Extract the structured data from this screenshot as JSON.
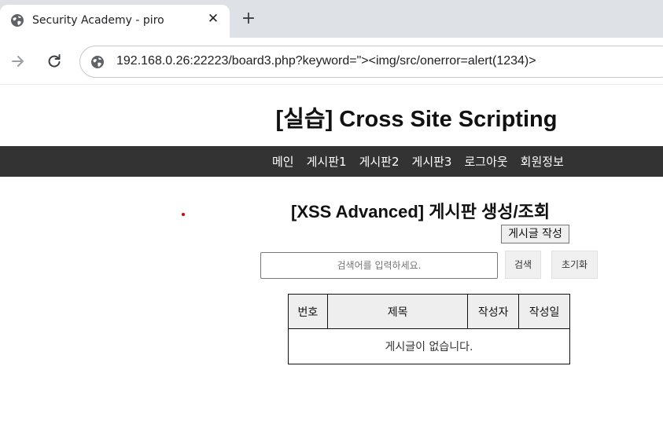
{
  "browser": {
    "tab_title": "Security Academy - piro",
    "close_glyph": "✕",
    "new_tab_glyph": "+",
    "url": "192.168.0.26:22223/board3.php?keyword=\"><img/src/onerror=alert(1234)>"
  },
  "page": {
    "title": "[실습] Cross Site Scripting",
    "nav": [
      "메인",
      "게시판1",
      "게시판2",
      "게시판3",
      "로그아웃",
      "회원정보"
    ],
    "section_title": "[XSS Advanced] 게시판 생성/조회",
    "write_button": "게시글 작성",
    "search": {
      "placeholder": "검색어를 입력하세요.",
      "search_button": "검색",
      "reset_button": "초기화"
    },
    "table": {
      "headers": [
        "번호",
        "제목",
        "작성자",
        "작성일"
      ],
      "empty_message": "게시글이 없습니다."
    }
  },
  "colors": {
    "nav_background": "#333333",
    "tabstrip_background": "#dee1e6",
    "table_header_background": "#eeeeee",
    "injected_dot": "#d40000"
  }
}
